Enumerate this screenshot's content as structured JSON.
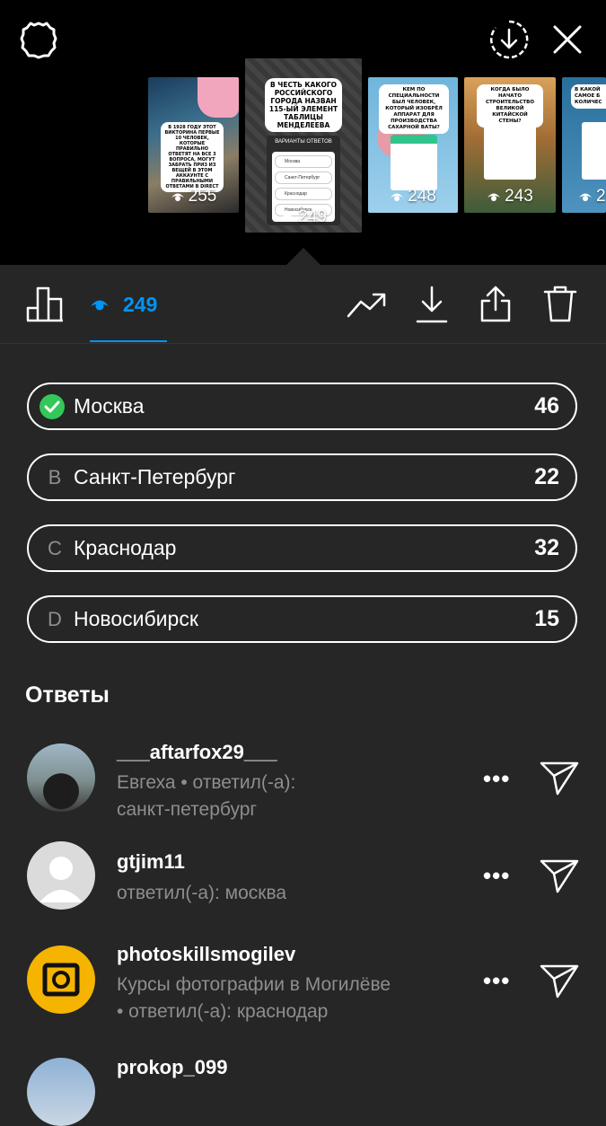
{
  "stories": [
    {
      "views": "255",
      "text": "В 1928 ГОДУ ЭТОТ ВИКТОРИНА ПЕРВЫЕ 10 ЧЕЛОВЕК, КОТОРЫЕ ПРАВИЛЬНО ОТВЕТЯТ НА ВСЕ 3 ВОПРОСА, МОГУТ ЗАБРАТЬ ПРИЗ ИЗ ВЕЩЕЙ В ЭТОМ АККАУНТЕ С ПРАВИЛЬНЫМИ ОТВЕТАМИ В DIRECT"
    },
    {
      "views": "249",
      "text": "В ЧЕСТЬ КАКОГО РОССИЙСКОГО ГОРОДА НАЗВАН 115-ЫЙ ЭЛЕМЕНТ ТАБЛИЦЫ МЕНДЕЛЕЕВА",
      "sub": "ВАРИАНТЫ ОТВЕТОВ",
      "options": [
        "Москва",
        "Санкт-Петербург",
        "Краснодар",
        "Новосибирск"
      ]
    },
    {
      "views": "248",
      "text": "КЕМ ПО СПЕЦИАЛЬНОСТИ БЫЛ ЧЕЛОВЕК, КОТОРЫЙ ИЗОБРЁЛ АППАРАТ ДЛЯ ПРОИЗВОДСТВА САХАРНОЙ ВАТЫ?"
    },
    {
      "views": "243",
      "text": "КОГДА БЫЛО НАЧАТО СТРОИТЕЛЬСТВО ВЕЛИКОЙ КИТАЙСКОЙ СТЕНЫ?"
    },
    {
      "views": "2",
      "text": "В КАКОЙ САМОЕ Б КОЛИЧЕС"
    }
  ],
  "toolbar": {
    "view_count": "249"
  },
  "poll": {
    "options": [
      {
        "letter": "",
        "label": "Москва",
        "count": "46",
        "correct": true
      },
      {
        "letter": "B",
        "label": "Санкт-Петербург",
        "count": "22"
      },
      {
        "letter": "C",
        "label": "Краснодар",
        "count": "32"
      },
      {
        "letter": "D",
        "label": "Новосибирск",
        "count": "15"
      }
    ]
  },
  "responses": {
    "title": "Ответы",
    "items": [
      {
        "username": "___aftarfox29___",
        "line1": "Евгеха • ответил(-а):",
        "line2": "санкт-петербург",
        "more": "•••"
      },
      {
        "username": "gtjim11",
        "line1": "ответил(-а): москва",
        "line2": "",
        "more": "•••"
      },
      {
        "username": "photoskillsmogilev",
        "line1": "Курсы фотографии в Могилёве",
        "line2": "• ответил(-а): краснодар",
        "more": "•••"
      },
      {
        "username": "prokop_099",
        "line1": "",
        "line2": "",
        "more": ""
      }
    ]
  },
  "colors": {
    "accent": "#0095f6",
    "correct": "#34c759",
    "background": "#262626",
    "top": "#000000"
  }
}
